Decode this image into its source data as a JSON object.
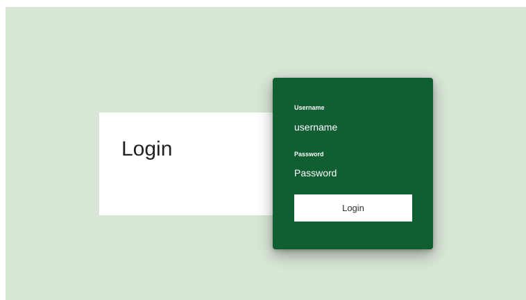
{
  "title_card": {
    "title": "Login"
  },
  "login_form": {
    "username_label": "Username",
    "username_placeholder": "username",
    "password_label": "Password",
    "password_placeholder": "Password",
    "submit_label": "Login"
  },
  "colors": {
    "page_background": "#d8e6d6",
    "panel_background": "#115e33",
    "card_background": "#ffffff"
  }
}
